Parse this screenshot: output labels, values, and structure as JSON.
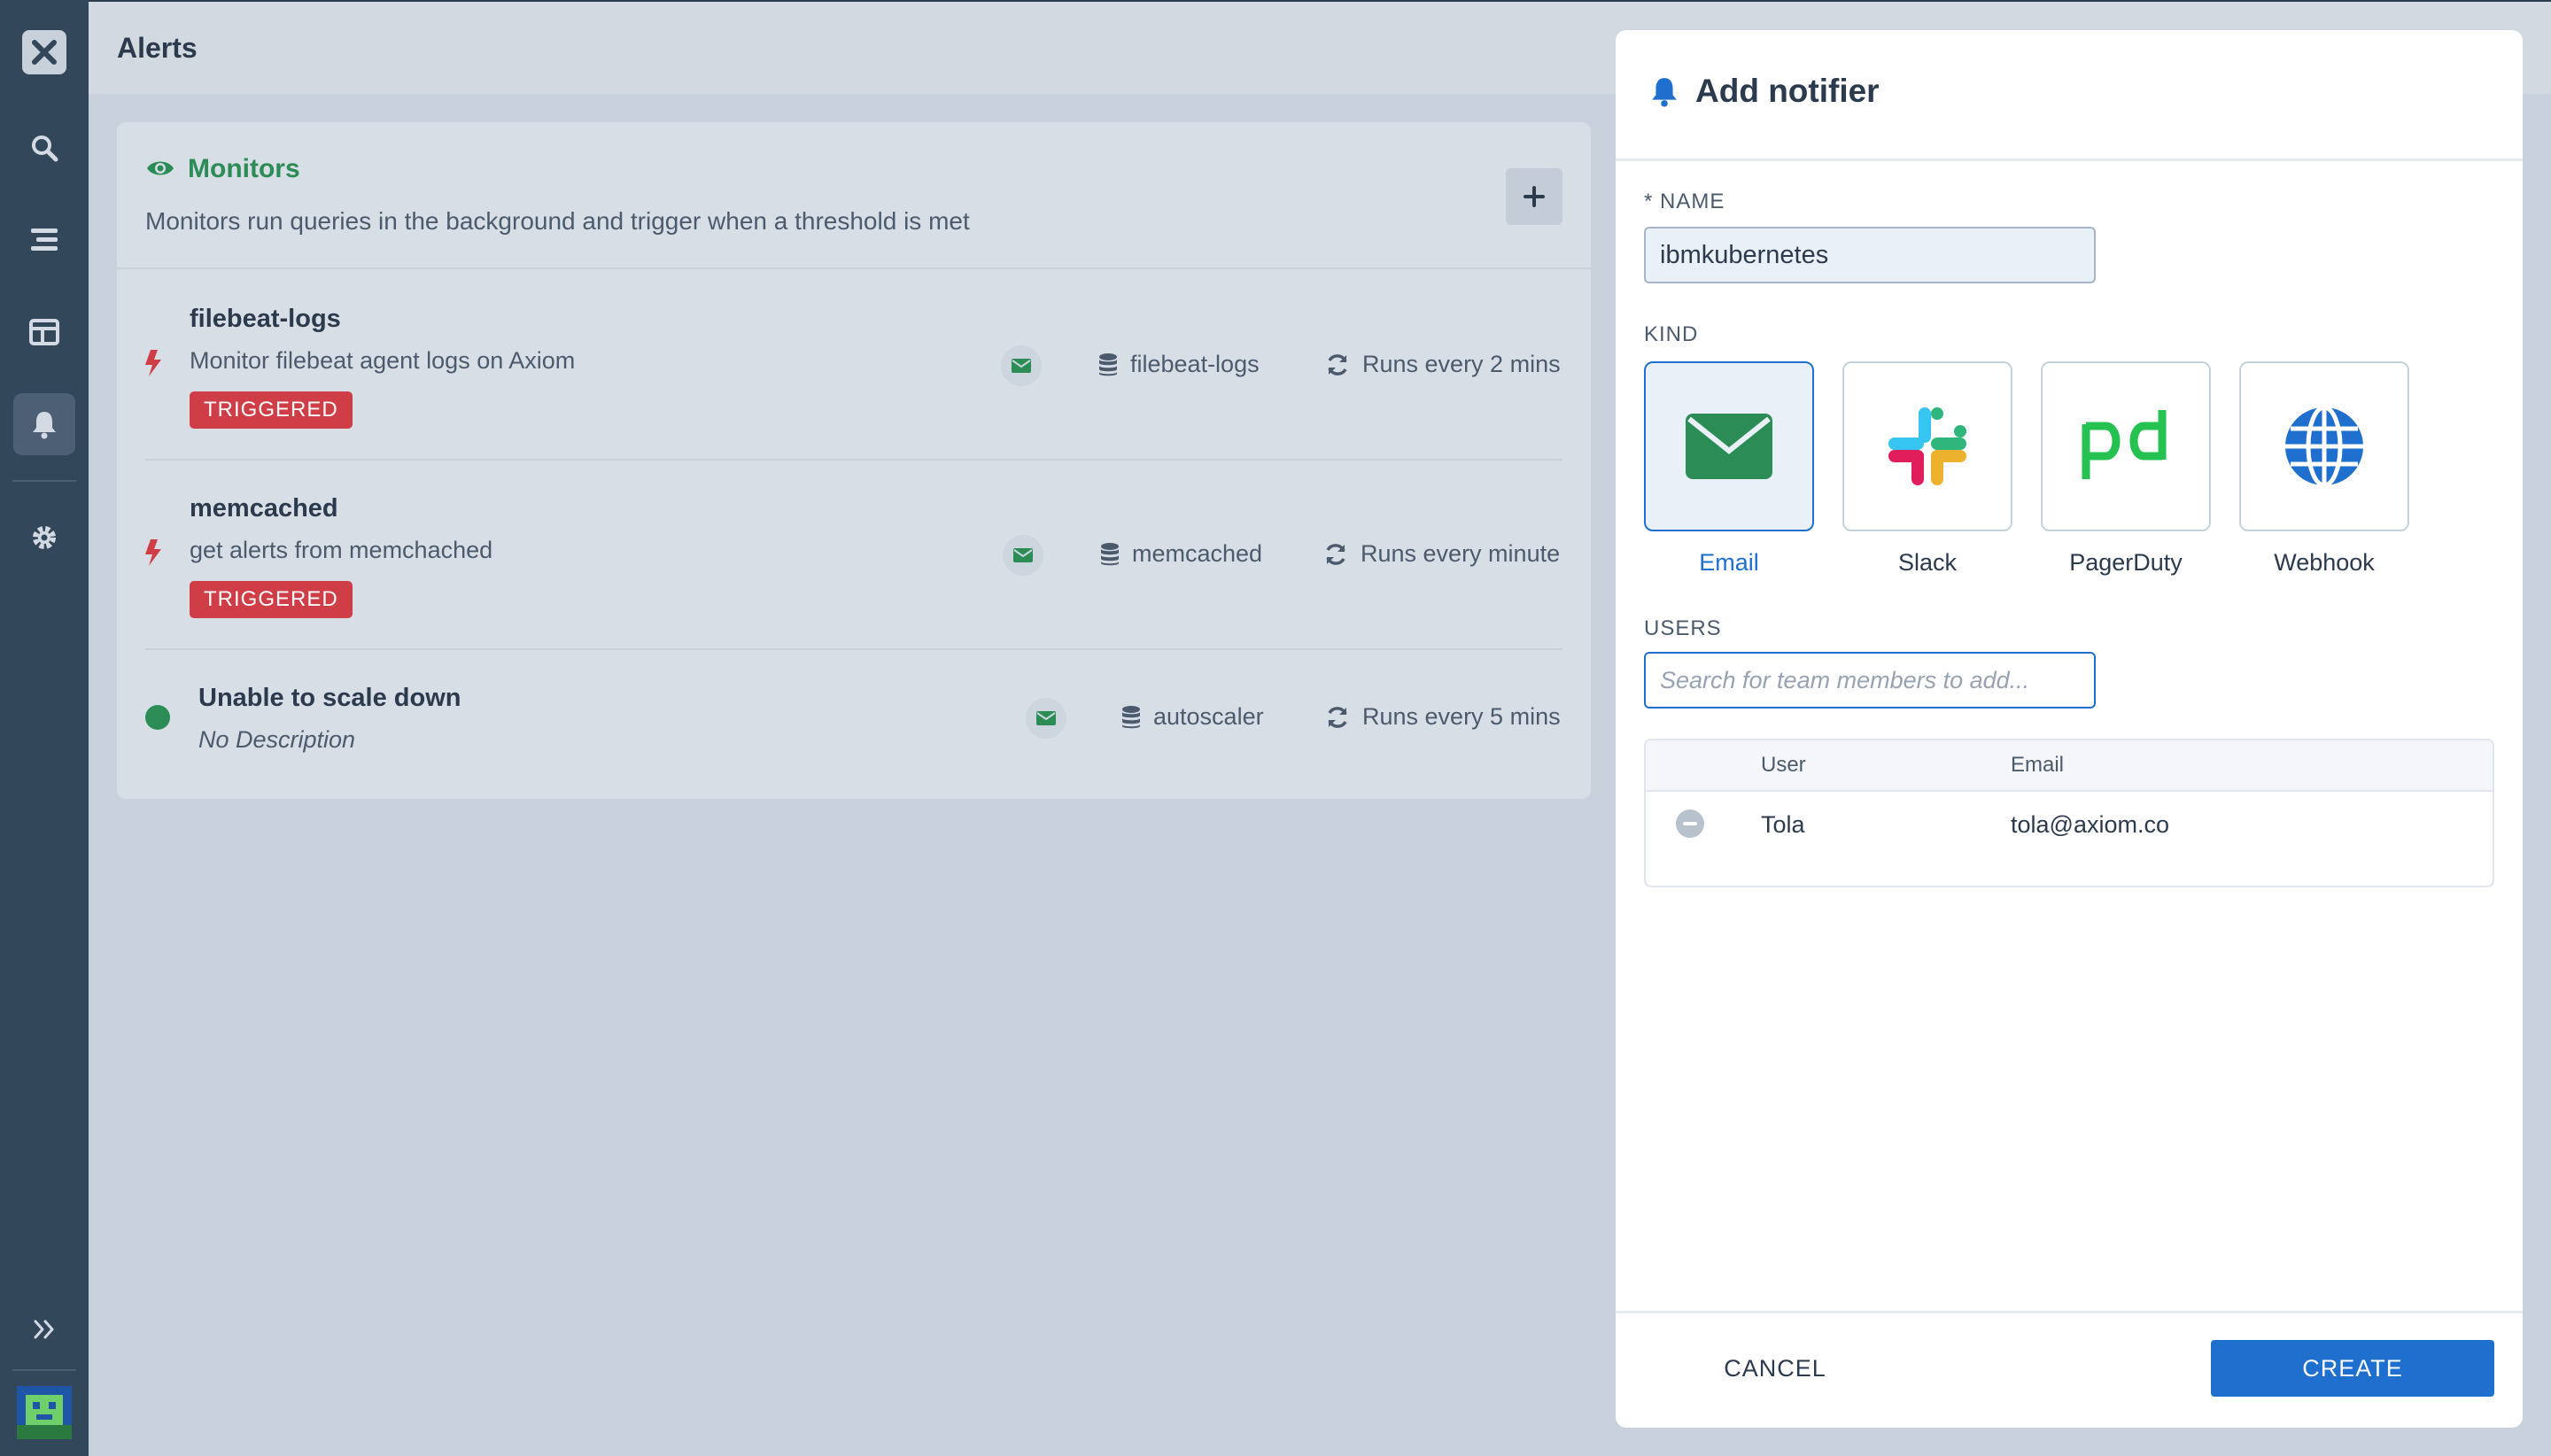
{
  "header": {
    "title": "Alerts"
  },
  "sidebar": {
    "items": [
      {
        "icon": "search-icon"
      },
      {
        "icon": "stream-icon"
      },
      {
        "icon": "dashboard-icon"
      },
      {
        "icon": "bell-icon"
      },
      {
        "icon": "gear-icon"
      }
    ],
    "active": "bell-icon",
    "colors": {
      "background": "#33475b",
      "active": "#4c5f74"
    }
  },
  "monitors": {
    "title": "Monitors",
    "subtitle": "Monitors run queries in the background and trigger when a threshold is met",
    "add_label": "+",
    "items": [
      {
        "name": "filebeat-logs",
        "description": "Monitor filebeat agent logs on Axiom",
        "status": "TRIGGERED",
        "dataset": "filebeat-logs",
        "frequency": "Runs every 2 mins"
      },
      {
        "name": "memcached",
        "description": "get alerts from memchached",
        "status": "TRIGGERED",
        "dataset": "memcached",
        "frequency": "Runs every minute"
      },
      {
        "name": "Unable to scale down",
        "description": "No Description",
        "status": "ok",
        "dataset": "autoscaler",
        "frequency": "Runs every 5 mins"
      }
    ]
  },
  "modal": {
    "title": "Add notifier",
    "name_label": "* NAME",
    "name_value": "ibmkubernetes",
    "kind_label": "KIND",
    "kinds": [
      {
        "label": "Email",
        "icon": "email-icon",
        "selected": true
      },
      {
        "label": "Slack",
        "icon": "slack-icon",
        "selected": false
      },
      {
        "label": "PagerDuty",
        "icon": "pagerduty-icon",
        "selected": false
      },
      {
        "label": "Webhook",
        "icon": "globe-icon",
        "selected": false
      }
    ],
    "users_label": "USERS",
    "search_placeholder": "Search for team members to add...",
    "table": {
      "headers": [
        "User",
        "Email"
      ],
      "rows": [
        {
          "user": "Tola",
          "email": "tola@axiom.co"
        }
      ]
    },
    "cancel_label": "CANCEL",
    "create_label": "CREATE"
  },
  "colors": {
    "accent": "#1f6fce",
    "triggered": "#cf3e46",
    "ok": "#2b8c56"
  }
}
